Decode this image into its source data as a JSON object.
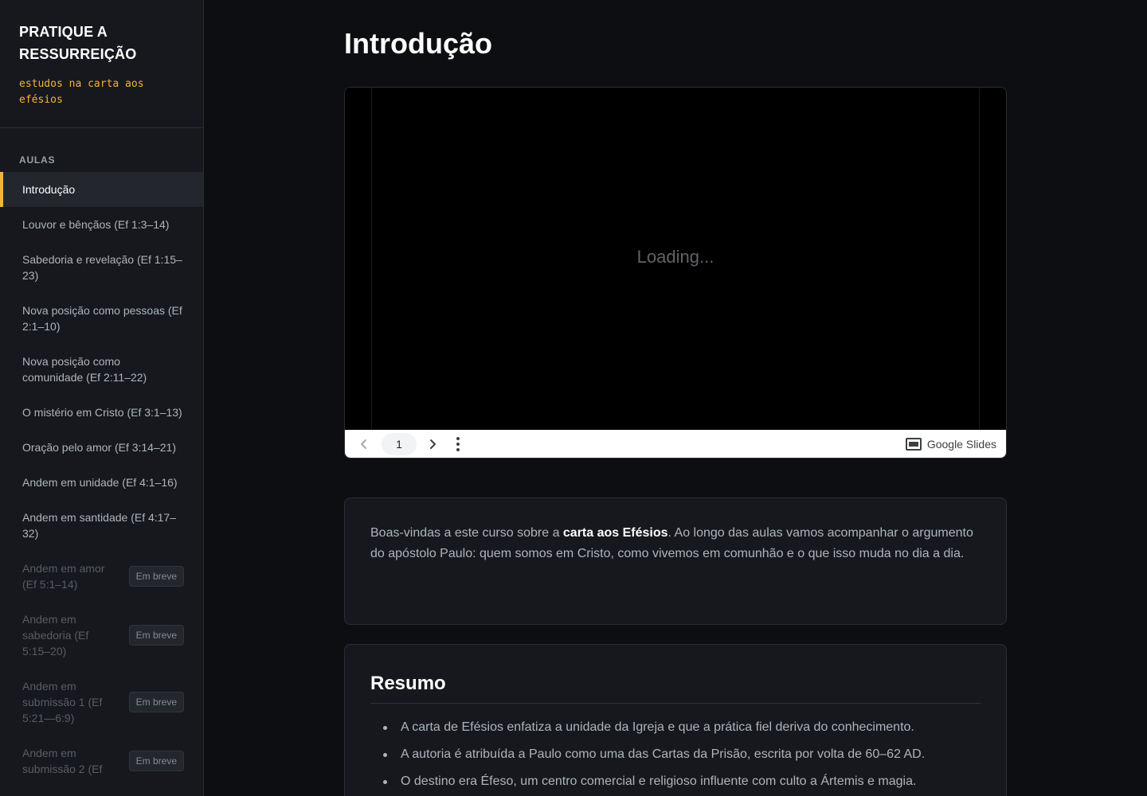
{
  "sidebar": {
    "brand_title": "PRATIQUE A RESSURREIÇÃO",
    "brand_subtitle": "estudos na carta aos efésios",
    "section_label": "AULAS",
    "items": [
      {
        "label": "Introdução",
        "state": "active"
      },
      {
        "label": "Louvor e bênçãos (Ef 1:3–14)",
        "state": "normal"
      },
      {
        "label": "Sabedoria e revelação (Ef 1:15–23)",
        "state": "normal"
      },
      {
        "label": "Nova posição como pessoas (Ef 2:1–10)",
        "state": "normal"
      },
      {
        "label": "Nova posição como comunidade (Ef 2:11–22)",
        "state": "normal"
      },
      {
        "label": "O mistério em Cristo (Ef 3:1–13)",
        "state": "normal"
      },
      {
        "label": "Oração pelo amor (Ef 3:14–21)",
        "state": "normal"
      },
      {
        "label": "Andem em unidade (Ef 4:1–16)",
        "state": "normal"
      },
      {
        "label": "Andem em santidade (Ef 4:17–32)",
        "state": "normal"
      },
      {
        "label": "Andem em amor (Ef 5:1–14)",
        "state": "disabled",
        "badge": "Em breve"
      },
      {
        "label": "Andem em sabedoria (Ef 5:15–20)",
        "state": "disabled",
        "badge": "Em breve"
      },
      {
        "label": "Andem em submissão 1 (Ef 5:21—6:9)",
        "state": "disabled",
        "badge": "Em breve"
      },
      {
        "label": "Andem em submissão 2 (Ef",
        "state": "disabled",
        "badge": "Em breve"
      }
    ]
  },
  "main": {
    "title": "Introdução",
    "slides": {
      "loading_text": "Loading...",
      "page_number": "1",
      "provider_label": "Google Slides",
      "prev_icon": "chevron-left-icon",
      "next_icon": "chevron-right-icon",
      "more_icon": "more-vertical-icon"
    },
    "intro": {
      "before": "Boas-vindas a este curso sobre a ",
      "highlight": "carta aos Efésios",
      "after": ". Ao longo das aulas vamos acompanhar o argumento do apóstolo Paulo: quem somos em Cristo, como vivemos em comunhão e o que isso muda no dia a dia."
    },
    "summary": {
      "title": "Resumo",
      "items": [
        "A carta de Efésios enfatiza a unidade da Igreja e que a prática fiel deriva do conhecimento.",
        "A autoria é atribuída a Paulo como uma das Cartas da Prisão, escrita por volta de 60–62 AD.",
        "O destino era Éfeso, um centro comercial e religioso influente com culto a Ártemis e magia."
      ]
    }
  },
  "colors": {
    "accent": "#f2b53a",
    "background": "#0d0e11",
    "sidebar_bg": "#16181d",
    "card_bg": "#16181d"
  }
}
